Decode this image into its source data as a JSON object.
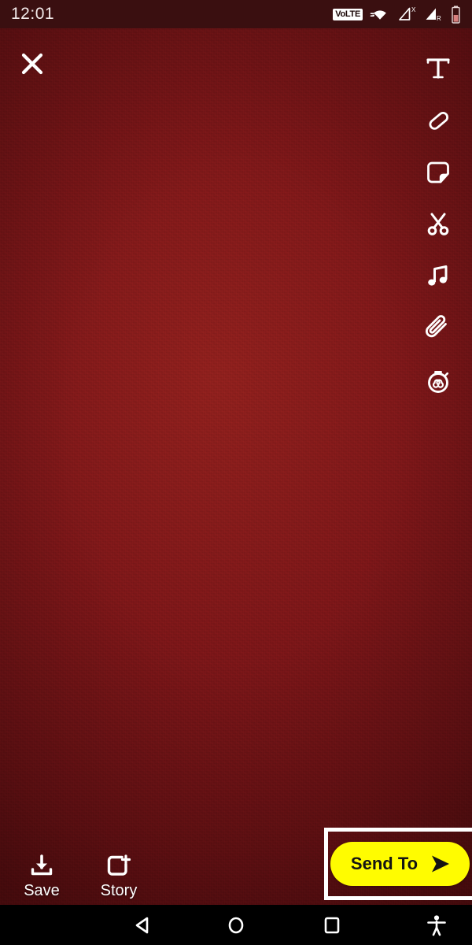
{
  "status_bar": {
    "clock": "12:01",
    "volte_label": "VoLTE",
    "icons": [
      "volte-badge",
      "wifi-icon",
      "signal-no-sim-icon",
      "signal-roaming-icon",
      "battery-icon"
    ],
    "signal_x_label": "X",
    "signal_r_label": "R",
    "background_color": "#3a0f10"
  },
  "editor": {
    "background_color": "#7c1618",
    "close_button": {
      "name": "close-icon",
      "label": "Close"
    },
    "tools": [
      {
        "id": "text",
        "icon": "text-tool-icon",
        "label": "Text"
      },
      {
        "id": "draw",
        "icon": "pencil-draw-icon",
        "label": "Draw"
      },
      {
        "id": "sticker",
        "icon": "sticker-icon",
        "label": "Stickers"
      },
      {
        "id": "scissors",
        "icon": "scissors-icon",
        "label": "Scissors"
      },
      {
        "id": "music",
        "icon": "music-note-icon",
        "label": "Music"
      },
      {
        "id": "attach",
        "icon": "paperclip-icon",
        "label": "Attach Link"
      },
      {
        "id": "timer",
        "icon": "stopwatch-infinity-icon",
        "label": "Timer"
      }
    ]
  },
  "bottom_actions": [
    {
      "id": "save",
      "label": "Save",
      "icon": "download-icon"
    },
    {
      "id": "story",
      "label": "Story",
      "icon": "add-to-story-icon"
    }
  ],
  "send_to": {
    "label": "Send To",
    "icon": "send-arrow-icon",
    "button_color": "#fffc00",
    "text_color": "#131313",
    "highlight_color": "#ffffff"
  },
  "nav_bar": {
    "background_color": "#000000",
    "buttons": [
      {
        "id": "back",
        "icon": "back-triangle-icon",
        "label": "Back"
      },
      {
        "id": "home",
        "icon": "home-circle-icon",
        "label": "Home"
      },
      {
        "id": "recent",
        "icon": "recents-square-icon",
        "label": "Recent apps"
      },
      {
        "id": "a11y",
        "icon": "accessibility-icon",
        "label": "Accessibility"
      }
    ]
  }
}
